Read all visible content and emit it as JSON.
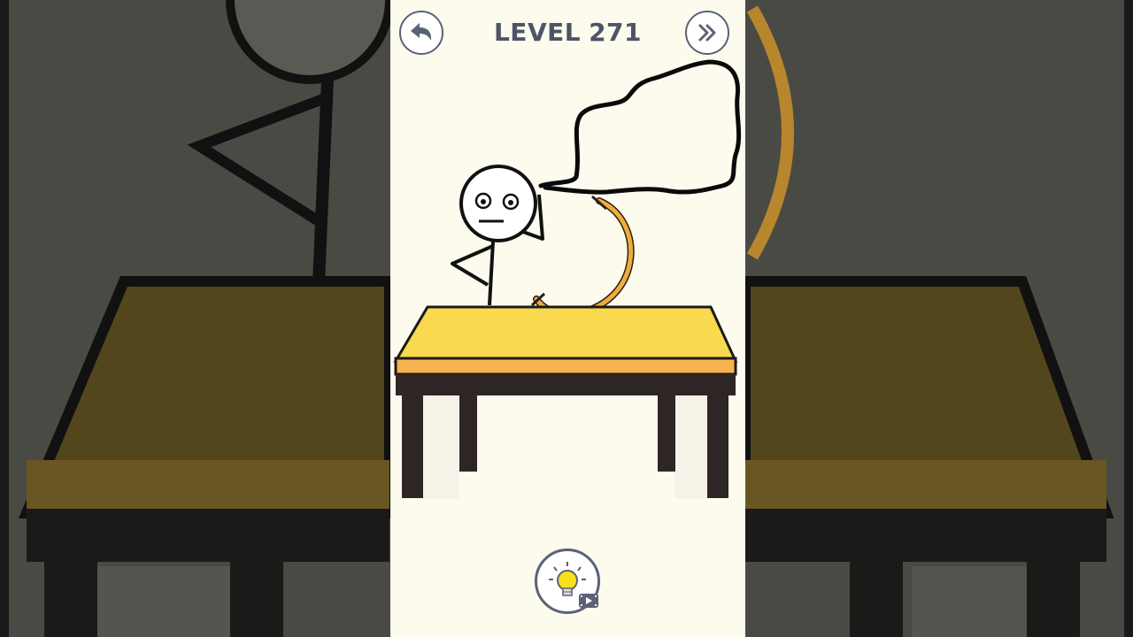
{
  "header": {
    "level_prefix": "LEVEL",
    "level_number": "271",
    "back_icon": "curved-back-arrow-icon",
    "skip_icon": "double-chevron-right-icon"
  },
  "hint": {
    "icon": "lightbulb-icon",
    "badge_icon": "video-ad-icon"
  },
  "colors": {
    "page_bg": "#fcfbee",
    "title": "#4d5468",
    "button_border": "#5b6275",
    "table_top": "#f9d94e",
    "table_edge": "#f5b24f",
    "table_legs": "#2e2624",
    "globe_stand": "#e8a83a",
    "globe_base": "#2e6fc5",
    "hint_bulb": "#f8e11a"
  }
}
